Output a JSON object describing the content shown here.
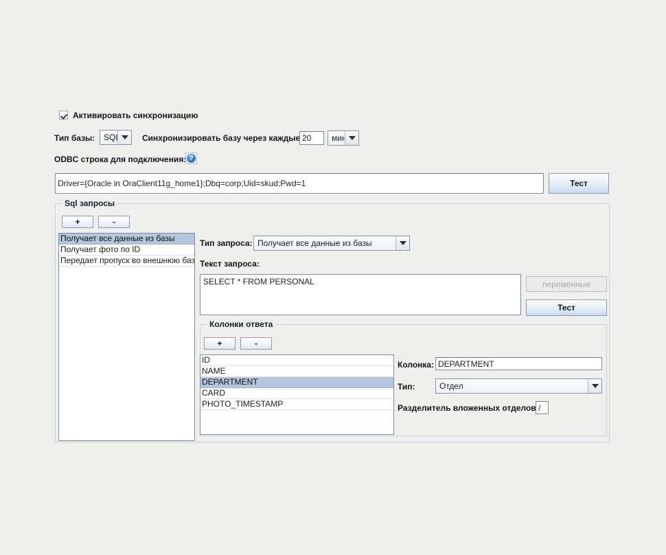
{
  "sync": {
    "enable_checkbox_label": "Активировать синхронизацию",
    "db_type_label": "Тип базы:",
    "db_type_value": "SQL",
    "interval_label": "Синхронизировать базу через каждые",
    "interval_value": "20",
    "interval_unit": "мин",
    "odbc_label": "ODBC строка для подключения:",
    "help_icon_glyph": "?",
    "odbc_value": "Driver={Oracle in OraClient11g_home1};Dbq=corp;Uid=skud;Pwd=1",
    "odbc_test_button": "Тест"
  },
  "queries_panel": {
    "title": "Sql запросы",
    "add_button": "+",
    "remove_button": "-",
    "items": [
      "Получает все данные из базы",
      "Получает фото по ID",
      "Передает пропуск во внешнюю базу"
    ],
    "selected_index": 0,
    "query_type_label": "Тип запроса:",
    "query_type_value": "Получает все данные из базы",
    "query_text_label": "Текст запроса:",
    "query_text_value": "SELECT * FROM PERSONAL",
    "variables_button": "переменные",
    "query_test_button": "Тест"
  },
  "columns_panel": {
    "title": "Колонки ответа",
    "add_button": "+",
    "remove_button": "-",
    "items": [
      "ID",
      "NAME",
      "DEPARTMENT",
      "CARD",
      "PHOTO_TIMESTAMP"
    ],
    "selected_index": 2,
    "column_label": "Колонка:",
    "column_value": "DEPARTMENT",
    "type_label": "Тип:",
    "type_value": "Отдел",
    "separator_label": "Разделитель вложенных отделов:",
    "separator_value": "/"
  },
  "colors": {
    "background": "#efefee",
    "selection": "#b3c6dd",
    "accent_button": "#c8dcf0",
    "border": "#c3d2e2"
  }
}
